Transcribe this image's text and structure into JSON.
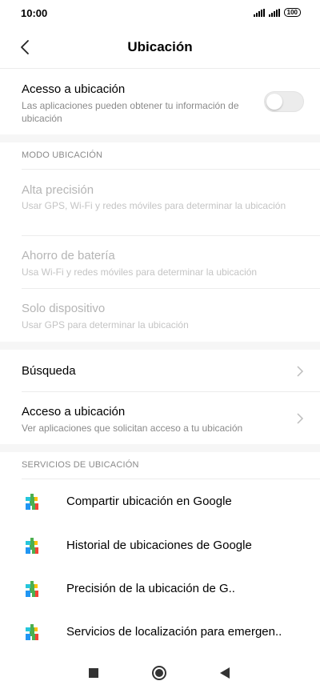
{
  "status": {
    "time": "10:00",
    "battery": "100"
  },
  "header": {
    "title": "Ubicación"
  },
  "location_access": {
    "title": "Acesso a ubicación",
    "subtitle": "Las aplicaciones pueden obtener tu información de ubicación",
    "enabled": false
  },
  "mode_section": {
    "header": "MODO UBICACIÓN",
    "items": [
      {
        "title": "Alta precisión",
        "subtitle": "Usar GPS, Wi-Fi y redes móviles para determinar la ubicación"
      },
      {
        "title": "Ahorro de batería",
        "subtitle": "Usa Wi-Fi y redes móviles para determinar la ubicación"
      },
      {
        "title": "Solo dispositivo",
        "subtitle": "Usar GPS para determinar la ubicación"
      }
    ]
  },
  "search": {
    "title": "Búsqueda"
  },
  "app_access": {
    "title": "Acceso a ubicación",
    "subtitle": "Ver aplicaciones que solicitan acceso a tu ubicación"
  },
  "services_section": {
    "header": "SERVICIOS DE UBICACIÓN",
    "items": [
      {
        "label": "Compartir ubicación en Google"
      },
      {
        "label": "Historial de ubicaciones de Google"
      },
      {
        "label": "Precisión de la ubicación de G.."
      },
      {
        "label": "Servicios de localización para emergen.."
      }
    ]
  },
  "icons": {
    "back": "back-arrow-icon",
    "chevron": "chevron-right-icon",
    "service": "google-play-services-icon",
    "nav_recents": "square-icon",
    "nav_home": "circle-icon",
    "nav_back": "triangle-back-icon"
  },
  "colors": {
    "secondary_text": "#8a8a8a",
    "disabled_text": "#b5b5b5",
    "separator": "#f6f6f6"
  }
}
